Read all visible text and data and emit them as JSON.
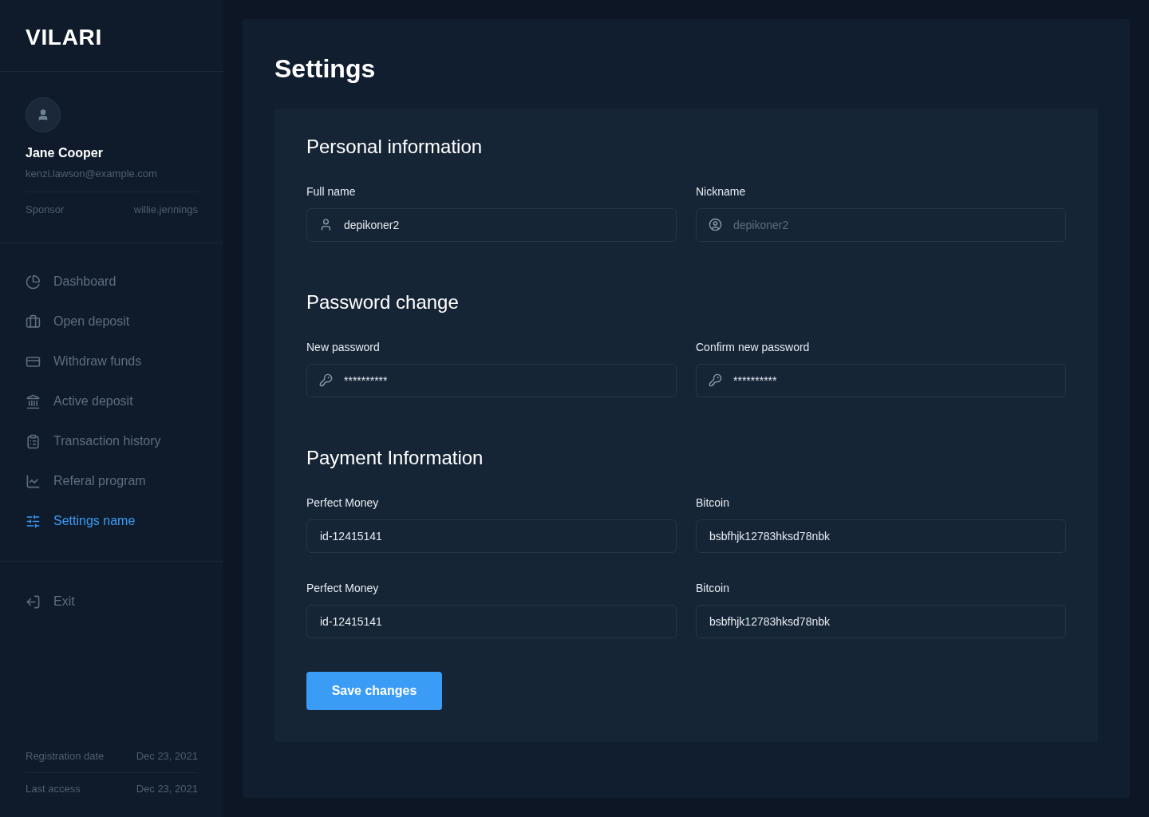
{
  "logo": "VILARI",
  "profile": {
    "name": "Jane Cooper",
    "email": "kenzi.lawson@example.com",
    "sponsor_label": "Sponsor",
    "sponsor": "willie.jennings"
  },
  "nav": [
    {
      "label": "Dashboard",
      "selected": false
    },
    {
      "label": "Open deposit",
      "selected": false
    },
    {
      "label": "Withdraw funds",
      "selected": false
    },
    {
      "label": "Active deposit",
      "selected": false
    },
    {
      "label": "Transaction history",
      "selected": false
    },
    {
      "label": "Referal program",
      "selected": false
    },
    {
      "label": "Settings name",
      "selected": true
    }
  ],
  "exit": "Exit",
  "meta": [
    {
      "label": "Registration date",
      "value": "Dec 23, 2021"
    },
    {
      "label": "Last access",
      "value": "Dec 23, 2021"
    }
  ],
  "title": "Settings",
  "sections": [
    {
      "title": "Personal information",
      "fields": [
        {
          "label": "Full name",
          "kind": "user",
          "value": "depikoner2"
        },
        {
          "label": "Nickname",
          "kind": "user-circle",
          "placeholder": "depikoner2"
        }
      ]
    },
    {
      "title": "Password change",
      "fields": [
        {
          "label": "New password",
          "kind": "key",
          "value": "**********"
        },
        {
          "label": "Confirm new password",
          "kind": "key",
          "value": "**********"
        }
      ]
    },
    {
      "title": "Payment Information",
      "fields": [
        {
          "label": "Perfect Money",
          "kind": "plain",
          "value": "id-12415141"
        },
        {
          "label": "Bitcoin",
          "kind": "plain",
          "value": "bsbfhjk12783hksd78nbk"
        },
        {
          "label": "Perfect Money",
          "kind": "plain",
          "value": "id-12415141"
        },
        {
          "label": "Bitcoin",
          "kind": "plain",
          "value": "bsbfhjk12783hksd78nbk"
        }
      ]
    }
  ],
  "save_button": "Save changes"
}
